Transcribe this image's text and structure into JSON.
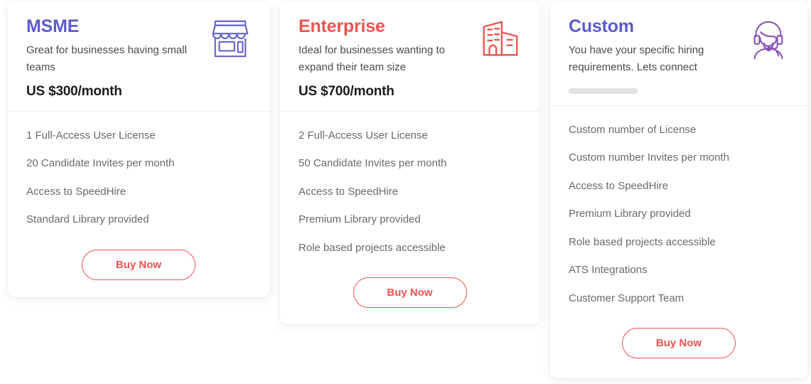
{
  "page": {
    "background_color": "#ffffff",
    "accent_indigo": "#5c5ccd",
    "accent_red": "#f0544f",
    "button_border_color": "#ef5350"
  },
  "plans": [
    {
      "id": "msme",
      "title": "MSME",
      "title_color": "#5c5ccd",
      "description": "Great for businesses having small teams",
      "price": "US $300/month",
      "icon_name": "storefront-icon",
      "icon_color": "#5c5ccd",
      "features": [
        "1 Full-Access User License",
        "20 Candidate Invites per month",
        "Access to SpeedHire",
        "Standard Library provided"
      ],
      "cta_label": "Buy Now"
    },
    {
      "id": "enterprise",
      "title": "Enterprise",
      "title_color": "#f0544f",
      "description": "Ideal for businesses wanting to expand their team size",
      "price": "US $700/month",
      "icon_name": "office-buildings-icon",
      "icon_color": "#ef5350",
      "features": [
        "2 Full-Access User License",
        "50 Candidate Invites per month",
        "Access to SpeedHire",
        "Premium Library provided",
        "Role based projects accessible"
      ],
      "cta_label": "Buy Now"
    },
    {
      "id": "custom",
      "title": "Custom",
      "title_color": "#5c5ccd",
      "description": "You have your specific hiring requirements. Lets connect",
      "price": "",
      "icon_name": "support-agent-headset-icon",
      "icon_color": "#8a55b5",
      "features": [
        "Custom number of License",
        "Custom number Invites per month",
        "Access to SpeedHire",
        "Premium Library provided",
        "Role based projects accessible",
        "ATS Integrations",
        "Customer Support Team"
      ],
      "cta_label": "Buy Now"
    }
  ]
}
